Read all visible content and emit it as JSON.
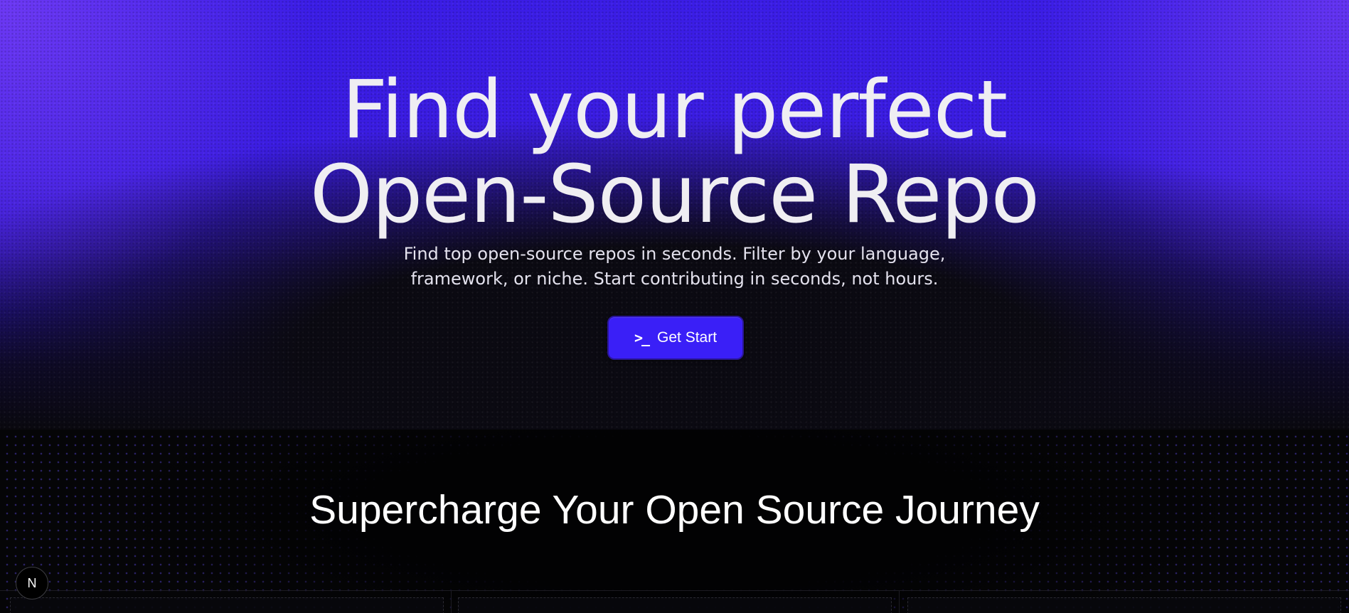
{
  "hero": {
    "title_line1": "Find your perfect",
    "title_line2": "Open-Source Repo",
    "subtitle_line1": "Find top open-source repos in seconds. Filter by your language,",
    "subtitle_line2": "framework, or niche. Start contributing in seconds, not hours.",
    "cta": {
      "icon": "terminal-prompt-icon",
      "icon_glyph": ">_",
      "label": "Get Start"
    }
  },
  "features": {
    "title": "Supercharge Your Open Source Journey"
  },
  "badge": {
    "icon": "nextjs-logo-icon",
    "glyph": "N"
  },
  "colors": {
    "accent": "#3a1ff7",
    "hero_top": "#3b1de6",
    "background": "#050507",
    "text": "#efeef2"
  }
}
